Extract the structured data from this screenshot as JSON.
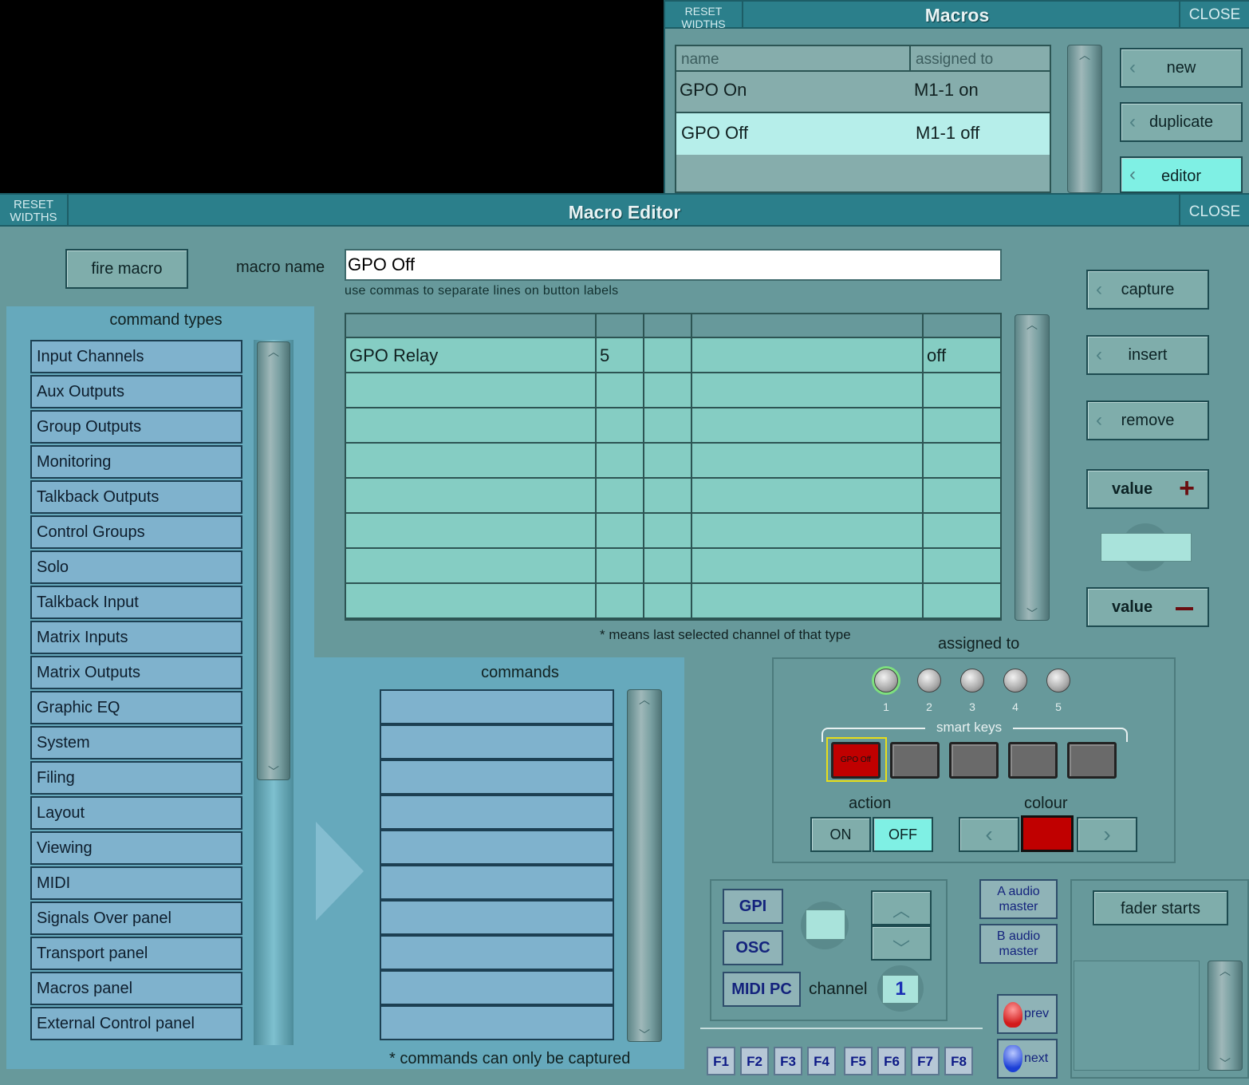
{
  "macros": {
    "title": "Macros",
    "reset_label": "RESET WIDTHS",
    "close_label": "CLOSE",
    "columns": [
      "name",
      "assigned to"
    ],
    "rows": [
      {
        "name": "GPO On",
        "assigned": "M1-1 on"
      },
      {
        "name": "GPO Off",
        "assigned": "M1-1 off"
      }
    ],
    "buttons": {
      "new": "new",
      "duplicate": "duplicate",
      "editor": "editor"
    }
  },
  "editor": {
    "title": "Macro Editor",
    "reset_label": "RESET WIDTHS",
    "close_label": "CLOSE",
    "fire_macro": "fire macro",
    "macro_name_label": "macro name",
    "macro_name_value": "GPO Off",
    "hint": "use commas to separate lines on button labels",
    "command_types_title": "command types",
    "command_types": [
      "Input Channels",
      "Aux Outputs",
      "Group Outputs",
      "Monitoring",
      "Talkback Outputs",
      "Control Groups",
      "Solo",
      "Talkback Input",
      "Matrix Inputs",
      "Matrix Outputs",
      "Graphic EQ",
      "System",
      "Filing",
      "Layout",
      "Viewing",
      "MIDI",
      "Signals Over panel",
      "Transport panel",
      "Macros panel",
      "External Control panel"
    ],
    "grid_rows": [
      [
        "GPO Relay",
        "5",
        "",
        "",
        "off"
      ],
      [
        "",
        "",
        "",
        "",
        ""
      ],
      [
        "",
        "",
        "",
        "",
        ""
      ],
      [
        "",
        "",
        "",
        "",
        ""
      ],
      [
        "",
        "",
        "",
        "",
        ""
      ],
      [
        "",
        "",
        "",
        "",
        ""
      ],
      [
        "",
        "",
        "",
        "",
        ""
      ],
      [
        "",
        "",
        "",
        "",
        ""
      ]
    ],
    "grid_note": "* means last selected channel of that type",
    "commands_title": "commands",
    "commands_note": "* commands can only be captured",
    "capture": "capture",
    "insert": "insert",
    "remove": "remove",
    "value_plus": "value",
    "value_minus": "value",
    "assigned_to": "assigned to",
    "knobs": [
      "1",
      "2",
      "3",
      "4",
      "5"
    ],
    "smart_keys": "smart keys",
    "smart_key_1_label": "GPO Off",
    "action_label": "action",
    "action_on": "ON",
    "action_off": "OFF",
    "colour_label": "colour",
    "colour_selected": "#c00000",
    "gpi": "GPI",
    "osc": "OSC",
    "midi_pc": "MIDI PC",
    "channel_label": "channel",
    "channel_value": "1",
    "a_audio_master": "A audio master",
    "b_audio_master": "B audio master",
    "prev": "prev",
    "next": "next",
    "fader_starts": "fader starts",
    "fkeys": [
      "F1",
      "F2",
      "F3",
      "F4",
      "F5",
      "F6",
      "F7",
      "F8"
    ]
  }
}
